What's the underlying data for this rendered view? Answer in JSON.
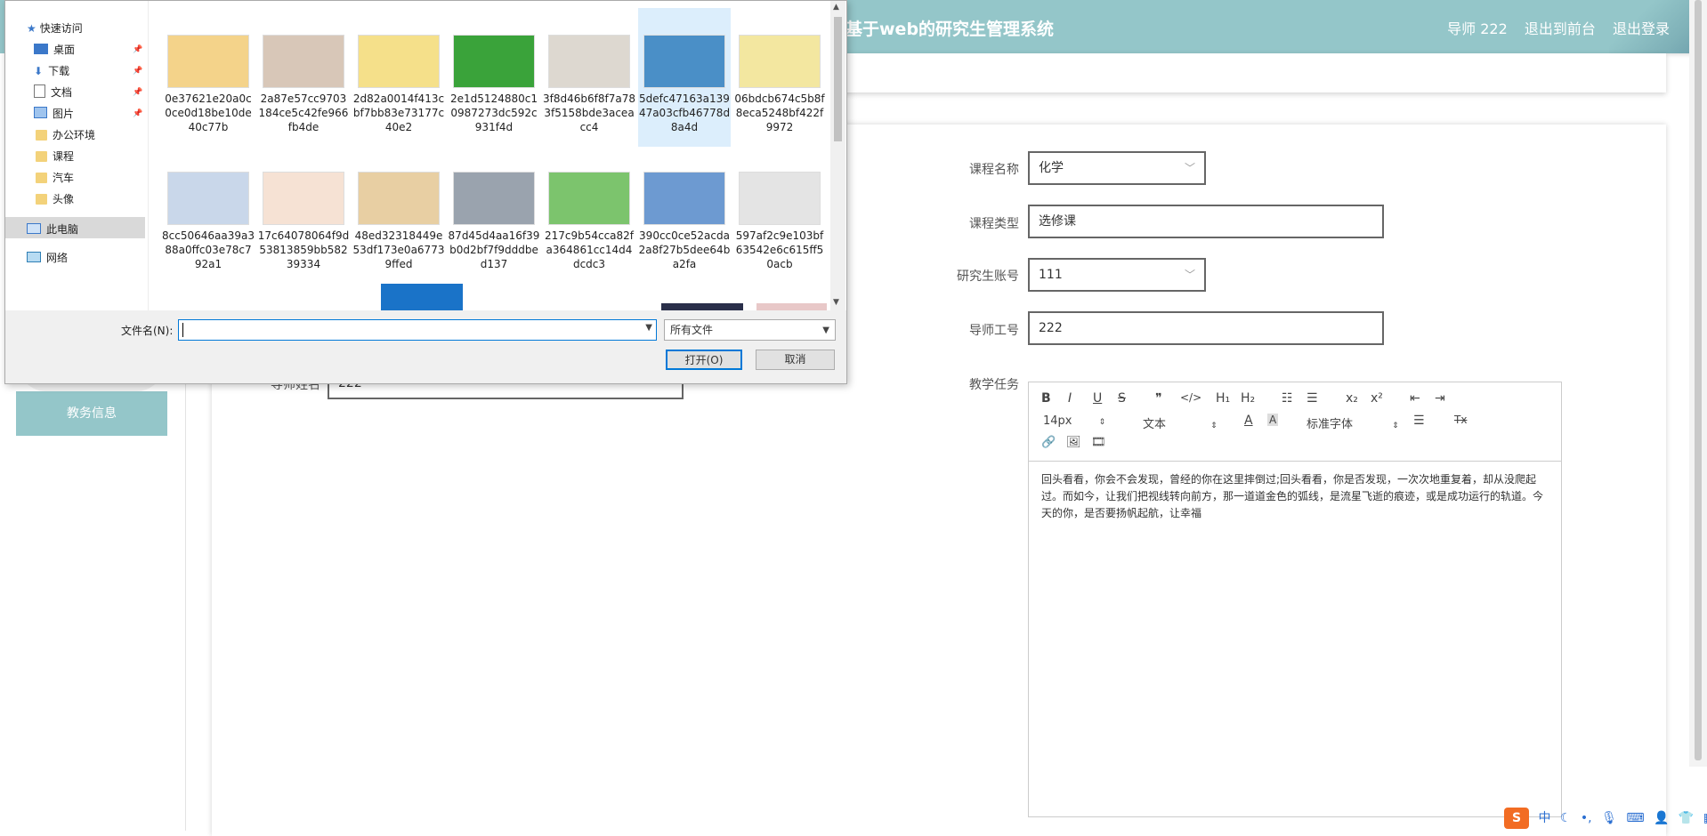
{
  "header": {
    "title": "基于web的研究生管理系统",
    "user": "导师 222",
    "back_to_front": "退出到前台",
    "logout": "退出登录"
  },
  "sidebar": {
    "edu_info": "教务信息"
  },
  "form": {
    "course_name_label": "课程名称",
    "course_name_value": "化学",
    "course_type_label": "课程类型",
    "course_type_value": "选修课",
    "student_account_label": "研究生账号",
    "student_account_value": "111",
    "tutor_id_label": "导师工号",
    "tutor_id_value": "222",
    "tutor_name_label": "导师姓名",
    "tutor_name_value": "222",
    "teaching_task_label": "教学任务"
  },
  "editor": {
    "toolbar": {
      "bold": "B",
      "italic": "I",
      "underline": "U",
      "strike": "S",
      "quote": "❞",
      "code": "</>",
      "h1": "H₁",
      "h2": "H₂",
      "ordered_list": "☷",
      "bullet_list": "☰",
      "subscript": "x₂",
      "superscript": "x²",
      "outdent": "⇤",
      "indent": "⇥",
      "font_size": "14px",
      "format": "文本",
      "font_family": "标准字体",
      "clear": "Tx"
    },
    "content": "回头看看，你会不会发现，曾经的你在这里摔倒过;回头看看，你是否发现，一次次地重复着，却从没爬起过。而如今，让我们把视线转向前方，那一道道金色的弧线，是流星飞逝的痕迹，或是成功运行的轨道。今天的你，是否要扬帆起航，让幸福"
  },
  "dialog": {
    "nav": {
      "quick_access": "快速访问",
      "desktop": "桌面",
      "downloads": "下载",
      "documents": "文档",
      "pictures": "图片",
      "office": "办公环境",
      "course": "课程",
      "car": "汽车",
      "avatar": "头像",
      "this_pc": "此电脑",
      "network": "网络"
    },
    "files": [
      {
        "name": "0e37621e20a0c0ce0d18be10de40c77b",
        "color": "#f4d38a"
      },
      {
        "name": "2a87e57cc9703184ce5c42fe966fb4de",
        "color": "#d8c7b8"
      },
      {
        "name": "2d82a0014f413cbf7bb83e73177c40e2",
        "color": "#f5e08a"
      },
      {
        "name": "2e1d5124880c10987273dc592c931f4d",
        "color": "#3aa33a"
      },
      {
        "name": "3f8d46b6f8f7a783f5158bde3aceacc4",
        "color": "#ddd8d0"
      },
      {
        "name": "5defc47163a13947a03cfb46778d8a4d",
        "color": "#4a8fc7"
      },
      {
        "name": "06bdcb674c5b8f8eca5248bf422f9972",
        "color": "#f3e7a0"
      },
      {
        "name": "8cc50646aa39a388a0ffc03e78c792a1",
        "color": "#c9d7ea"
      },
      {
        "name": "17c64078064f9d53813859bb58239334",
        "color": "#f6e2d4"
      },
      {
        "name": "48ed32318449e53df173e0a67739ffed",
        "color": "#e8cfa3"
      },
      {
        "name": "87d45d4aa16f39b0d2bf7f9dddbed137",
        "color": "#9aa3ae"
      },
      {
        "name": "217c9b54cca82fa364861cc14d4dcdc3",
        "color": "#7cc46d"
      },
      {
        "name": "390cc0ce52acda2a8f27b5dee64ba2fa",
        "color": "#6d9ad1"
      },
      {
        "name": "597af2c9e103bf63542e6c615ff50acb",
        "color": "#e4e4e4"
      }
    ],
    "filename_label": "文件名(N):",
    "filename_value": "",
    "filetype": "所有文件",
    "open_btn": "打开(O)",
    "cancel_btn": "取消"
  },
  "tray": {
    "ime": "S",
    "lang": "中"
  }
}
